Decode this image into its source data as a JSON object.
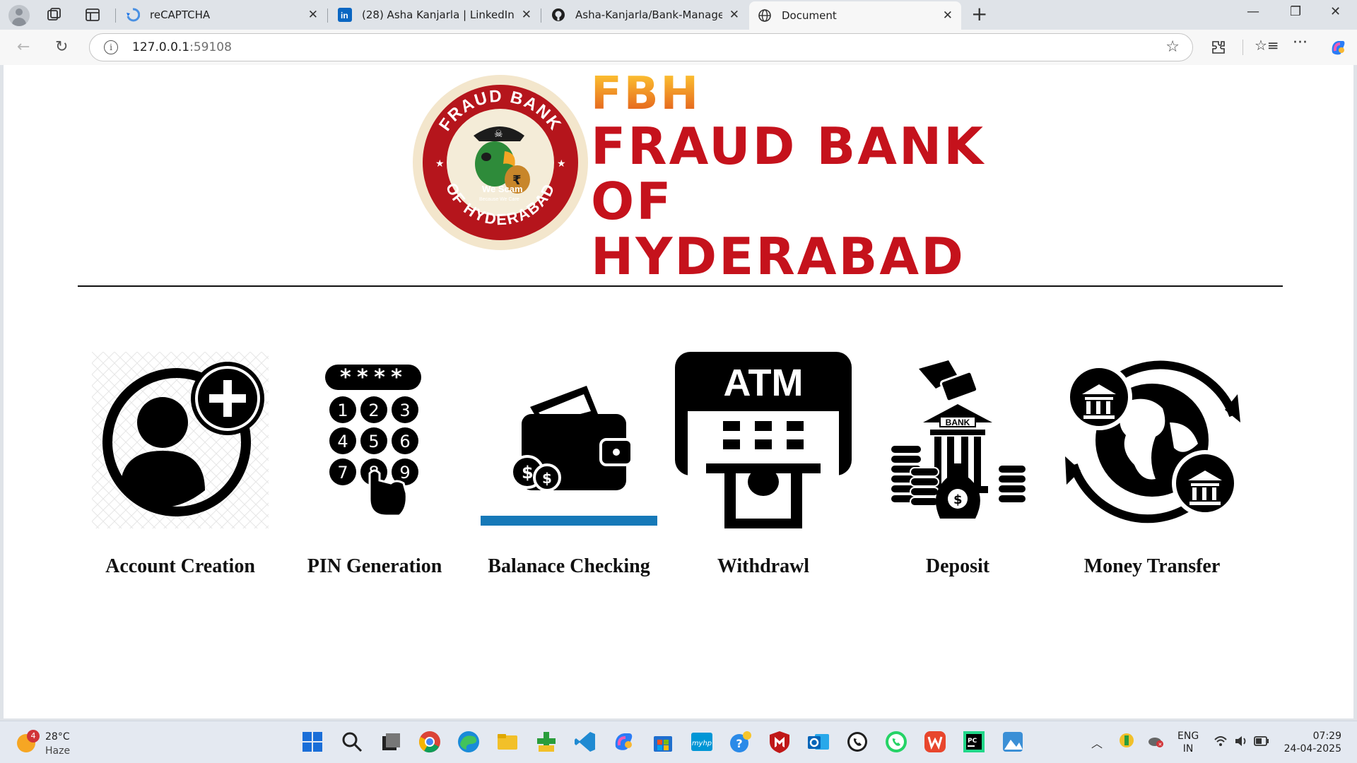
{
  "browser": {
    "tabs": [
      {
        "title": "reCAPTCHA",
        "icon": "recaptcha-icon"
      },
      {
        "title": "(28) Asha Kanjarla | LinkedIn",
        "icon": "linkedin-icon"
      },
      {
        "title": "Asha-Kanjarla/Bank-Management",
        "icon": "github-icon"
      },
      {
        "title": "Document",
        "icon": "globe-icon",
        "active": true
      }
    ],
    "address": {
      "host": "127.0.0.1",
      "port": ":59108"
    }
  },
  "page": {
    "brand": {
      "abbr": "FBH",
      "full": "FRAUD BANK OF HYDERABAD",
      "logo_text_top": "FRAUD BANK",
      "logo_text_bottom": "OF HYDERABAD",
      "logo_tagline": "We Scam",
      "logo_subtagline": "Because We Care"
    },
    "services": [
      {
        "label": "Account Creation",
        "icon": "add-user-icon"
      },
      {
        "label": "PIN Generation",
        "icon": "keypad-icon"
      },
      {
        "label": "Balanace Checking",
        "icon": "wallet-icon"
      },
      {
        "label": "Withdrawl",
        "icon": "atm-icon"
      },
      {
        "label": "Deposit",
        "icon": "bank-deposit-icon"
      },
      {
        "label": "Money Transfer",
        "icon": "globe-transfer-icon"
      }
    ],
    "atm_text": "ATM",
    "bank_text": "BANK",
    "keypad_mask": "****",
    "keypad_digits": [
      "1",
      "2",
      "3",
      "4",
      "5",
      "6",
      "7",
      "8",
      "9"
    ]
  },
  "taskbar": {
    "weather": {
      "temp": "28°C",
      "condition": "Haze",
      "badge": "4"
    },
    "language": {
      "line1": "ENG",
      "line2": "IN"
    },
    "clock": {
      "time": "07:29",
      "date": "24-04-2025"
    }
  },
  "colors": {
    "brand_red": "#c5121c",
    "brand_orange": "#f08a1b",
    "logo_ring": "#f3e6cc"
  }
}
